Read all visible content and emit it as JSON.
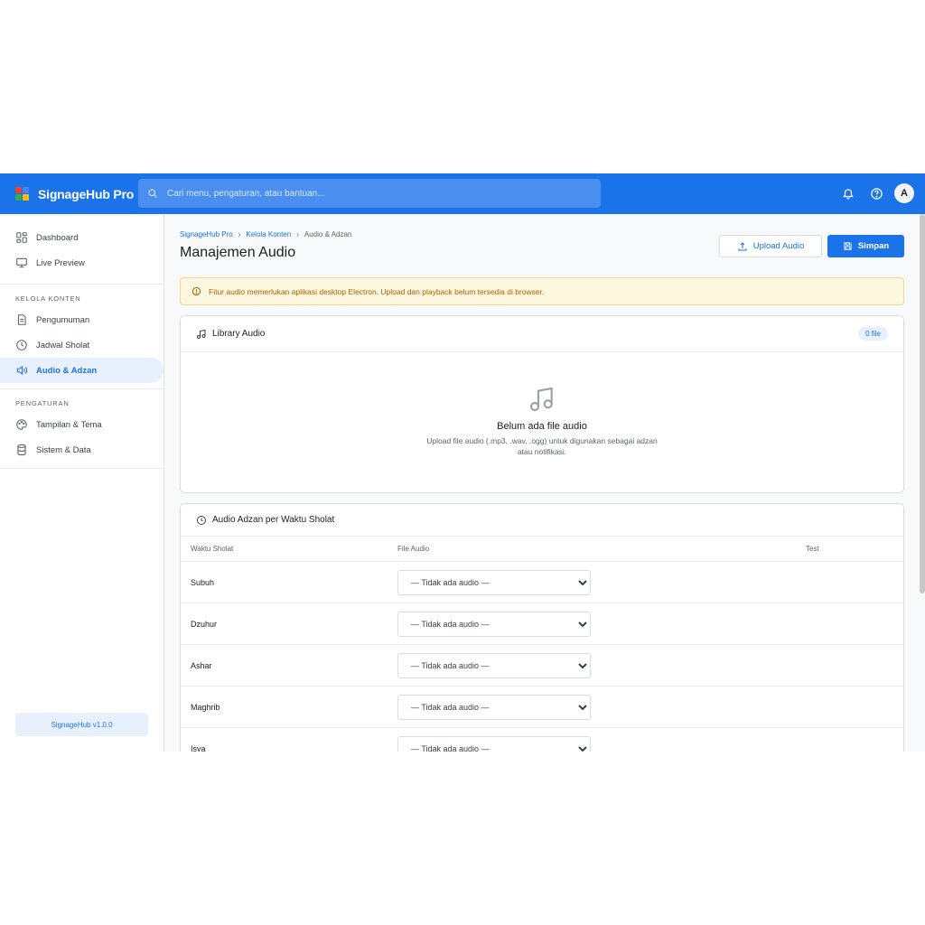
{
  "app": {
    "name": "SignageHub Pro",
    "logo_colors": [
      "#ea4335",
      "#4285f4",
      "#34a853",
      "#fbbc05"
    ]
  },
  "search": {
    "placeholder": "Cari menu, pengaturan, atau bantuan..."
  },
  "user": {
    "avatar_letter": "A"
  },
  "sidebar": {
    "top_items": [
      {
        "label": "Dashboard",
        "icon": "dashboard-icon"
      },
      {
        "label": "Live Preview",
        "icon": "monitor-icon"
      }
    ],
    "section_konten": "KELOLA KONTEN",
    "konten_items": [
      {
        "label": "Pengumuman",
        "icon": "document-icon"
      },
      {
        "label": "Jadwal Sholat",
        "icon": "clock-icon"
      },
      {
        "label": "Audio & Adzan",
        "icon": "speaker-icon",
        "active": true
      }
    ],
    "section_pengaturan": "PENGATURAN",
    "pengaturan_items": [
      {
        "label": "Tampilan & Tema",
        "icon": "palette-icon"
      },
      {
        "label": "Sistem & Data",
        "icon": "database-icon"
      }
    ],
    "version": "SignageHub v1.0.0"
  },
  "breadcrumb": [
    "SignageHub Pro",
    "Kelola Konten",
    "Audio & Adzan"
  ],
  "page": {
    "title": "Manajemen Audio",
    "upload_label": "Upload Audio",
    "save_label": "Simpan"
  },
  "alert": {
    "text": "Fitur audio memerlukan aplikasi desktop Electron. Upload dan playback belum tersedia di browser."
  },
  "library": {
    "title": "Library Audio",
    "count": "0 file",
    "empty_title": "Belum ada file audio",
    "empty_desc": "Upload file audio (.mp3, .wav, .ogg) untuk digunakan sebagai adzan atau notifikasi."
  },
  "adzan": {
    "title": "Audio Adzan per Waktu Sholat",
    "columns": [
      "Waktu Sholat",
      "File Audio",
      "Test"
    ],
    "rows": [
      {
        "name": "Subuh",
        "value": "— Tidak ada audio —"
      },
      {
        "name": "Dzuhur",
        "value": "— Tidak ada audio —"
      },
      {
        "name": "Ashar",
        "value": "— Tidak ada audio —"
      },
      {
        "name": "Maghrib",
        "value": "— Tidak ada audio —"
      },
      {
        "name": "Isya",
        "value": "— Tidak ada audio —"
      }
    ]
  },
  "colors": {
    "primary": "#1a73e8",
    "alert_bg": "#fef7e0",
    "alert_text": "#b06000"
  }
}
